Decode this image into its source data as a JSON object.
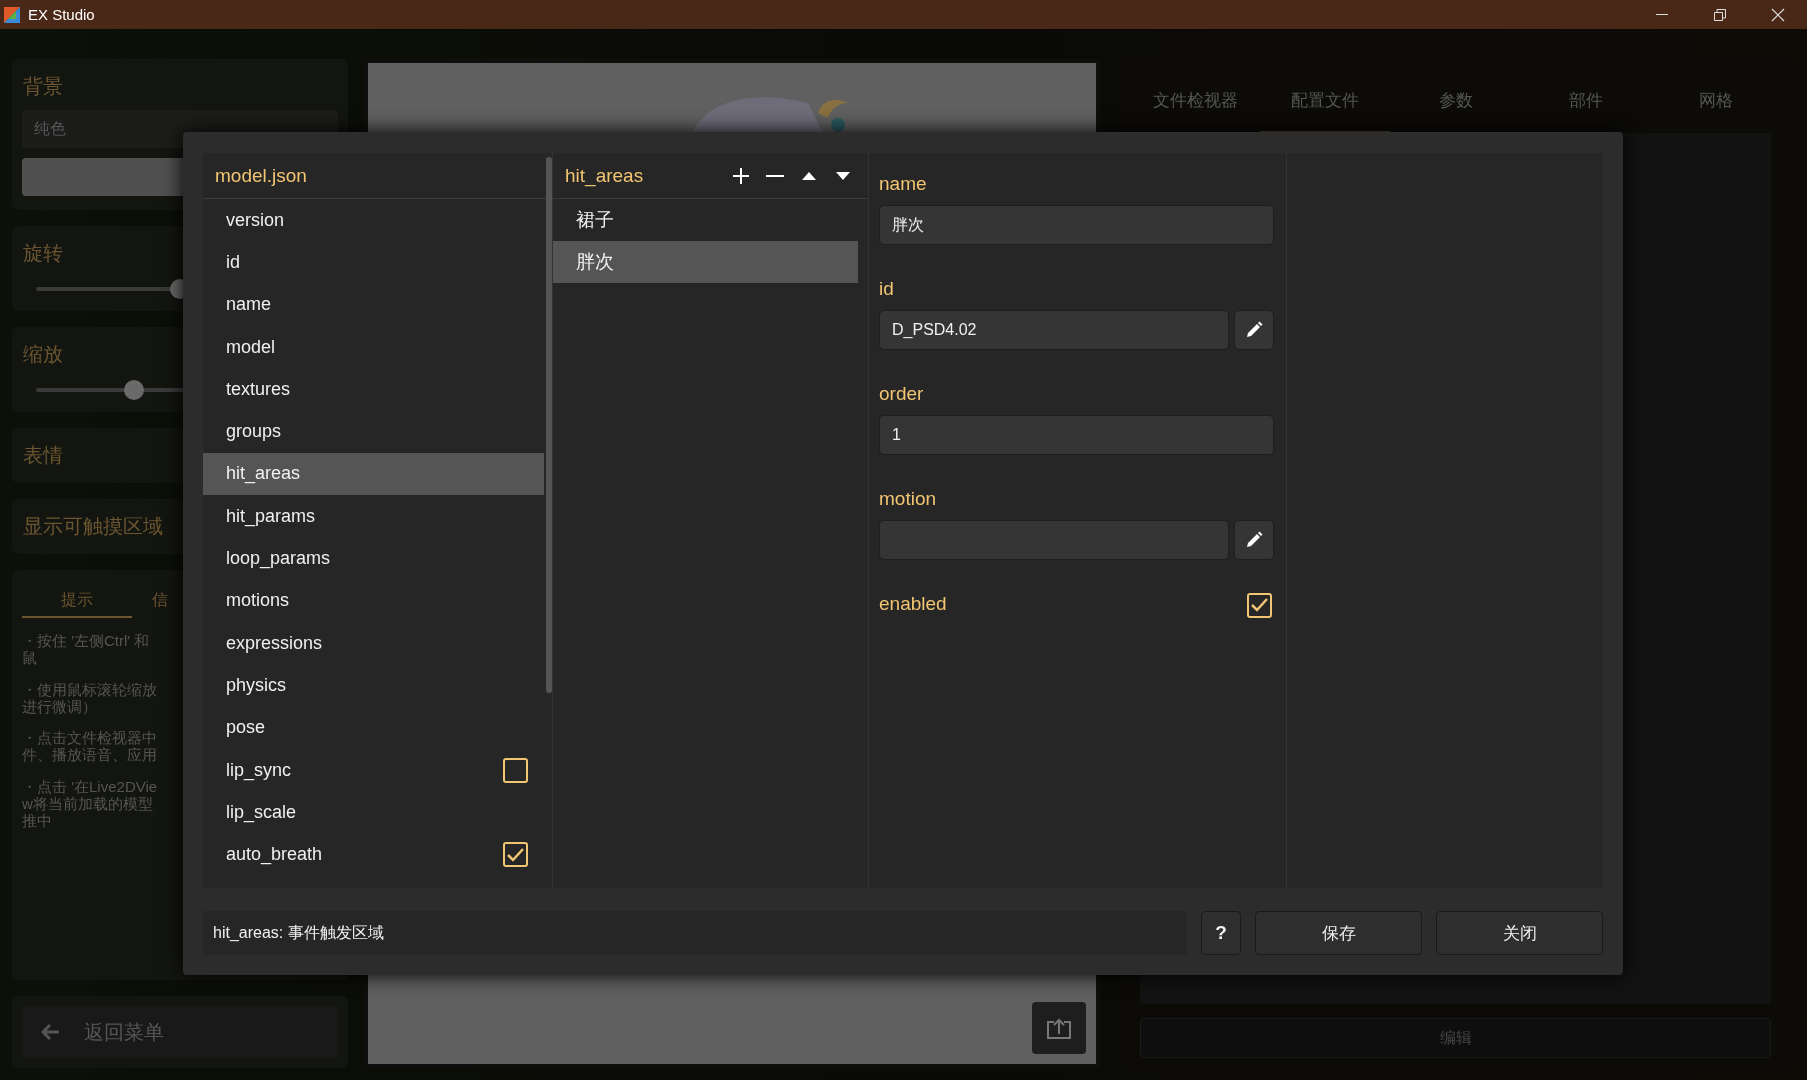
{
  "window": {
    "title": "EX Studio"
  },
  "sidebar": {
    "background_label": "背景",
    "background_mode": "纯色",
    "rotation": {
      "label": "旋转",
      "level": 0.5
    },
    "scale": {
      "label": "缩放",
      "level": 0.34
    },
    "expression_label": "表情",
    "touch_label": "显示可触摸区域",
    "tabs": [
      {
        "label": "提示",
        "selected": true
      },
      {
        "label": "信",
        "selected": false
      }
    ],
    "tips": [
      "・按住 '左侧Ctrl' 和鼠",
      "・使用鼠标滚轮缩放进行微调）",
      "・点击文件检视器中件、播放语音、应用",
      "・点击 '在Live2DView将当前加载的模型推中"
    ],
    "back_button": "返回菜单"
  },
  "right_panel": {
    "tabs": [
      {
        "label": "文件检视器",
        "selected": false
      },
      {
        "label": "配置文件",
        "selected": true
      },
      {
        "label": "参数",
        "selected": false
      },
      {
        "label": "部件",
        "selected": false
      },
      {
        "label": "网格",
        "selected": false
      }
    ],
    "edit_button": "编辑"
  },
  "dialog": {
    "file_header": "model.json",
    "keys": [
      {
        "label": "version",
        "kind": "plain",
        "selected": false
      },
      {
        "label": "id",
        "kind": "plain",
        "selected": false
      },
      {
        "label": "name",
        "kind": "plain",
        "selected": false
      },
      {
        "label": "model",
        "kind": "plain",
        "selected": false
      },
      {
        "label": "textures",
        "kind": "plain",
        "selected": false
      },
      {
        "label": "groups",
        "kind": "plain",
        "selected": false
      },
      {
        "label": "hit_areas",
        "kind": "plain",
        "selected": true
      },
      {
        "label": "hit_params",
        "kind": "plain",
        "selected": false
      },
      {
        "label": "loop_params",
        "kind": "plain",
        "selected": false
      },
      {
        "label": "motions",
        "kind": "plain",
        "selected": false
      },
      {
        "label": "expressions",
        "kind": "plain",
        "selected": false
      },
      {
        "label": "physics",
        "kind": "plain",
        "selected": false
      },
      {
        "label": "pose",
        "kind": "plain",
        "selected": false
      },
      {
        "label": "lip_sync",
        "kind": "bool",
        "checked": false,
        "selected": false
      },
      {
        "label": "lip_scale",
        "kind": "plain",
        "selected": false
      },
      {
        "label": "auto_breath",
        "kind": "bool",
        "checked": true,
        "selected": false
      }
    ],
    "array_header": "hit_areas",
    "entries": [
      {
        "label": "裙子",
        "selected": false
      },
      {
        "label": "胖次",
        "selected": true
      }
    ],
    "fields": [
      {
        "label": "name",
        "kind": "text",
        "value": "胖次"
      },
      {
        "label": "id",
        "kind": "text_edit",
        "value": "D_PSD4.02"
      },
      {
        "label": "order",
        "kind": "text",
        "value": "1"
      },
      {
        "label": "motion",
        "kind": "text_edit"
      },
      {
        "label": "enabled",
        "kind": "bool",
        "checked": true
      }
    ],
    "status": "hit_areas: 事件触发区域",
    "help_button": "?",
    "save_button": "保存",
    "close_button": "关闭"
  }
}
